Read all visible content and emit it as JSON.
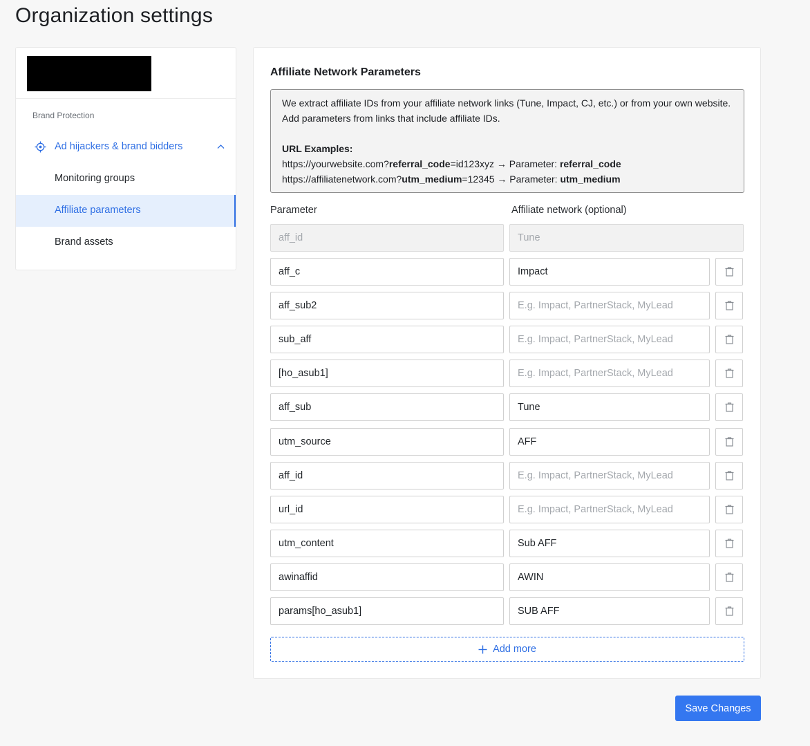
{
  "page": {
    "title": "Organization settings"
  },
  "sidebar": {
    "section_label": "Brand Protection",
    "parent_item": {
      "label": "Ad hijackers & brand bidders",
      "icon": "target-icon",
      "expanded": true
    },
    "items": [
      {
        "label": "Monitoring groups",
        "active": false
      },
      {
        "label": "Affiliate parameters",
        "active": true
      },
      {
        "label": "Brand assets",
        "active": false
      }
    ]
  },
  "card": {
    "title": "Affiliate Network Parameters",
    "info": {
      "intro": "We extract affiliate IDs from your affiliate network links (Tune, Impact, CJ, etc.) or from your own website. Add parameters from links that include affiliate IDs.",
      "examples_heading": "URL Examples:",
      "example1": {
        "prefix": "https://yourwebsite.com?",
        "key": "referral_code",
        "suffix": "=id123xyz → Parameter: ",
        "param": "referral_code"
      },
      "example2": {
        "prefix": "https://affiliatenetwork.com?",
        "key": "utm_medium",
        "suffix": "=12345 → Parameter: ",
        "param": "utm_medium"
      }
    },
    "col_parameter": "Parameter",
    "col_network": "Affiliate network (optional)",
    "network_placeholder": "E.g. Impact, PartnerStack, MyLead",
    "default_row": {
      "parameter": "aff_id",
      "network": "Tune"
    },
    "rows": [
      {
        "parameter": "aff_c",
        "network": "Impact"
      },
      {
        "parameter": "aff_sub2",
        "network": ""
      },
      {
        "parameter": "sub_aff",
        "network": ""
      },
      {
        "parameter": "[ho_asub1]",
        "network": ""
      },
      {
        "parameter": "aff_sub",
        "network": "Tune"
      },
      {
        "parameter": "utm_source",
        "network": "AFF"
      },
      {
        "parameter": "aff_id",
        "network": ""
      },
      {
        "parameter": "url_id",
        "network": ""
      },
      {
        "parameter": "utm_content",
        "network": "Sub AFF"
      },
      {
        "parameter": "awinaffid",
        "network": "AWIN"
      },
      {
        "parameter": "params[ho_asub1]",
        "network": "SUB AFF"
      }
    ],
    "add_more_label": "Add more"
  },
  "save_label": "Save Changes",
  "colors": {
    "accent": "#3477f0",
    "active_bg": "#e5effd"
  }
}
